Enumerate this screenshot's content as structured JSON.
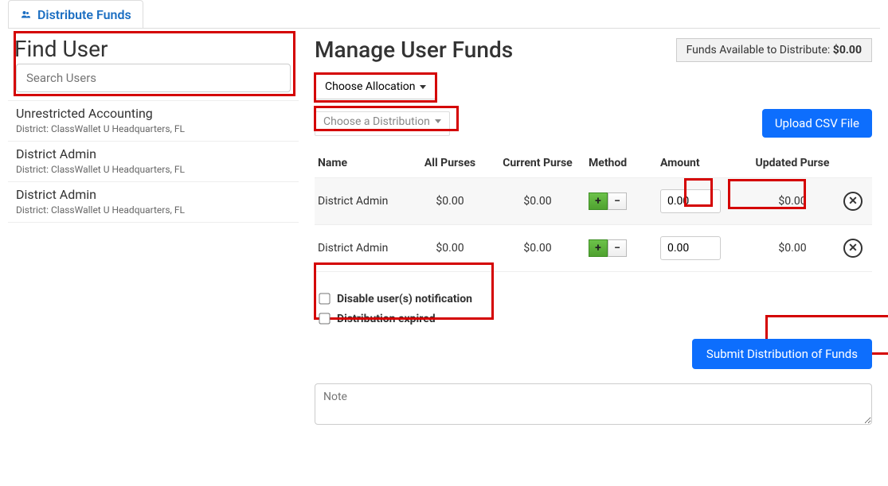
{
  "tab": {
    "label": "Distribute Funds"
  },
  "find_user": {
    "title": "Find User",
    "placeholder": "Search Users",
    "users": [
      {
        "name": "Unrestricted Accounting",
        "district": "District: ClassWallet U Headquarters, FL"
      },
      {
        "name": "District Admin",
        "district": "District: ClassWallet U Headquarters, FL"
      },
      {
        "name": "District Admin",
        "district": "District: ClassWallet U Headquarters, FL"
      }
    ]
  },
  "manage": {
    "title": "Manage User Funds",
    "funds_available_label": "Funds Available to Distribute: ",
    "funds_available_value": "$0.00",
    "choose_allocation": "Choose Allocation",
    "choose_distribution": "Choose a Distribution",
    "upload_csv": "Upload CSV File",
    "columns": {
      "name": "Name",
      "all_purses": "All Purses",
      "current_purse": "Current Purse",
      "method": "Method",
      "amount": "Amount",
      "updated_purse": "Updated Purse"
    },
    "rows": [
      {
        "name": "District Admin",
        "all": "$0.00",
        "current": "$0.00",
        "amount": "0.00",
        "updated": "$0.00"
      },
      {
        "name": "District Admin",
        "all": "$0.00",
        "current": "$0.00",
        "amount": "0.00",
        "updated": "$0.00"
      }
    ],
    "disable_notification_label": "Disable user(s) notification",
    "distribution_expired_label": "Distribution expired",
    "submit": "Submit Distribution of Funds",
    "note_placeholder": "Note"
  }
}
